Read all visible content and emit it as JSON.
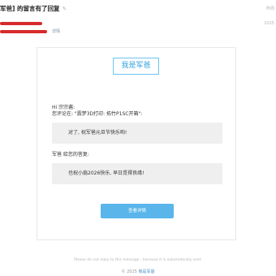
{
  "header": {
    "subject": "军爸] 的留言有了回复",
    "edit_icon": "edit-icon",
    "top_right": "昨周",
    "date": "2025",
    "detail_link": "详情"
  },
  "email": {
    "brand": "我是军爸",
    "greeting": "Hi 宗宗酱:",
    "comment_intro": "您评论在: \"震梦3D打印: 拓竹P1SC开箱\":",
    "comment": "对了, 祝军爸元旦节快乐哟!",
    "reply_intro": "军爸 给您的答复:",
    "reply": "也祝小扇2026快乐, 早日觅得良缘!",
    "button_label": "查看详情",
    "button_color": "#59b5ea"
  },
  "footer": {
    "note": "Please do not reply to this message , because it is automatically sent.",
    "copyright": "© 2025",
    "brand": "我是军爸"
  }
}
